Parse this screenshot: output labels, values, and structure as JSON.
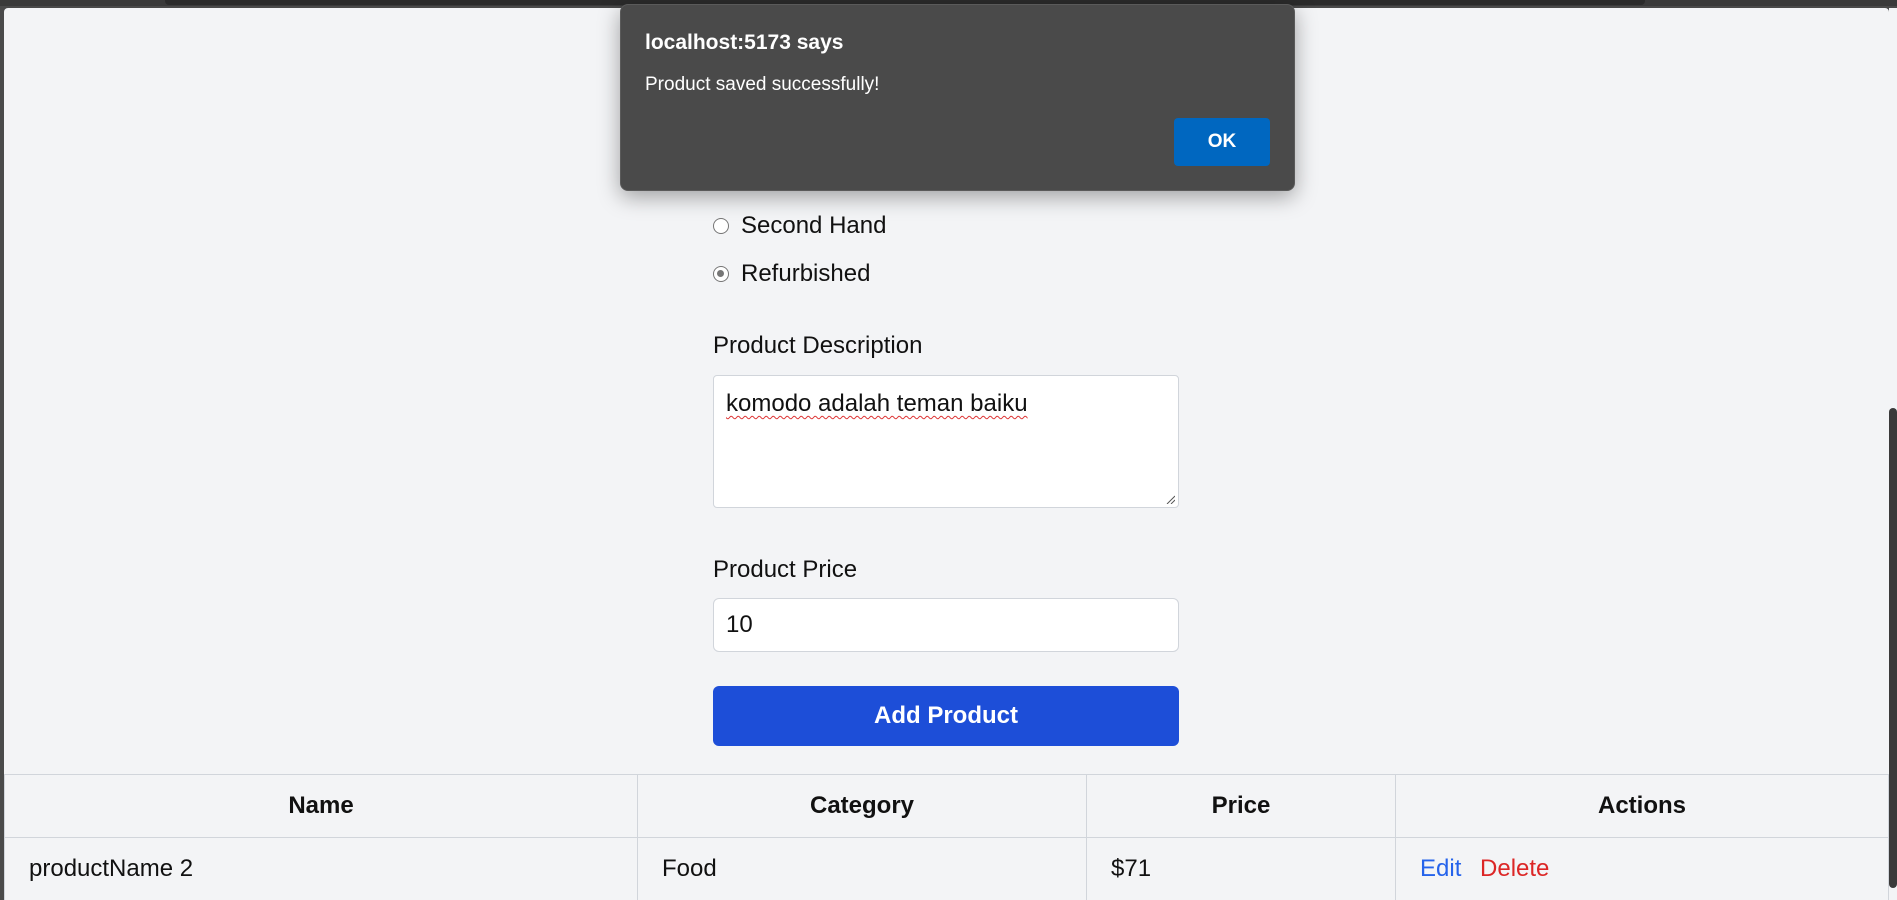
{
  "dialog": {
    "title": "localhost:5173 says",
    "message": "Product saved successfully!",
    "ok_label": "OK"
  },
  "form": {
    "condition_options": [
      {
        "label": "Second Hand",
        "checked": false
      },
      {
        "label": "Refurbished",
        "checked": true
      }
    ],
    "description_label": "Product Description",
    "description_value": "komodo adalah teman baiku",
    "price_label": "Product Price",
    "price_value": "10",
    "submit_label": "Add Product"
  },
  "table": {
    "headers": [
      "Name",
      "Category",
      "Price",
      "Actions"
    ],
    "rows": [
      {
        "name": "productName 2",
        "category": "Food",
        "price": "$71",
        "edit": "Edit",
        "delete": "Delete"
      }
    ]
  },
  "colors": {
    "primary_button": "#1d4ed8",
    "edit_link": "#2563eb",
    "delete_link": "#dc2626",
    "dialog_ok": "#0067c0"
  }
}
